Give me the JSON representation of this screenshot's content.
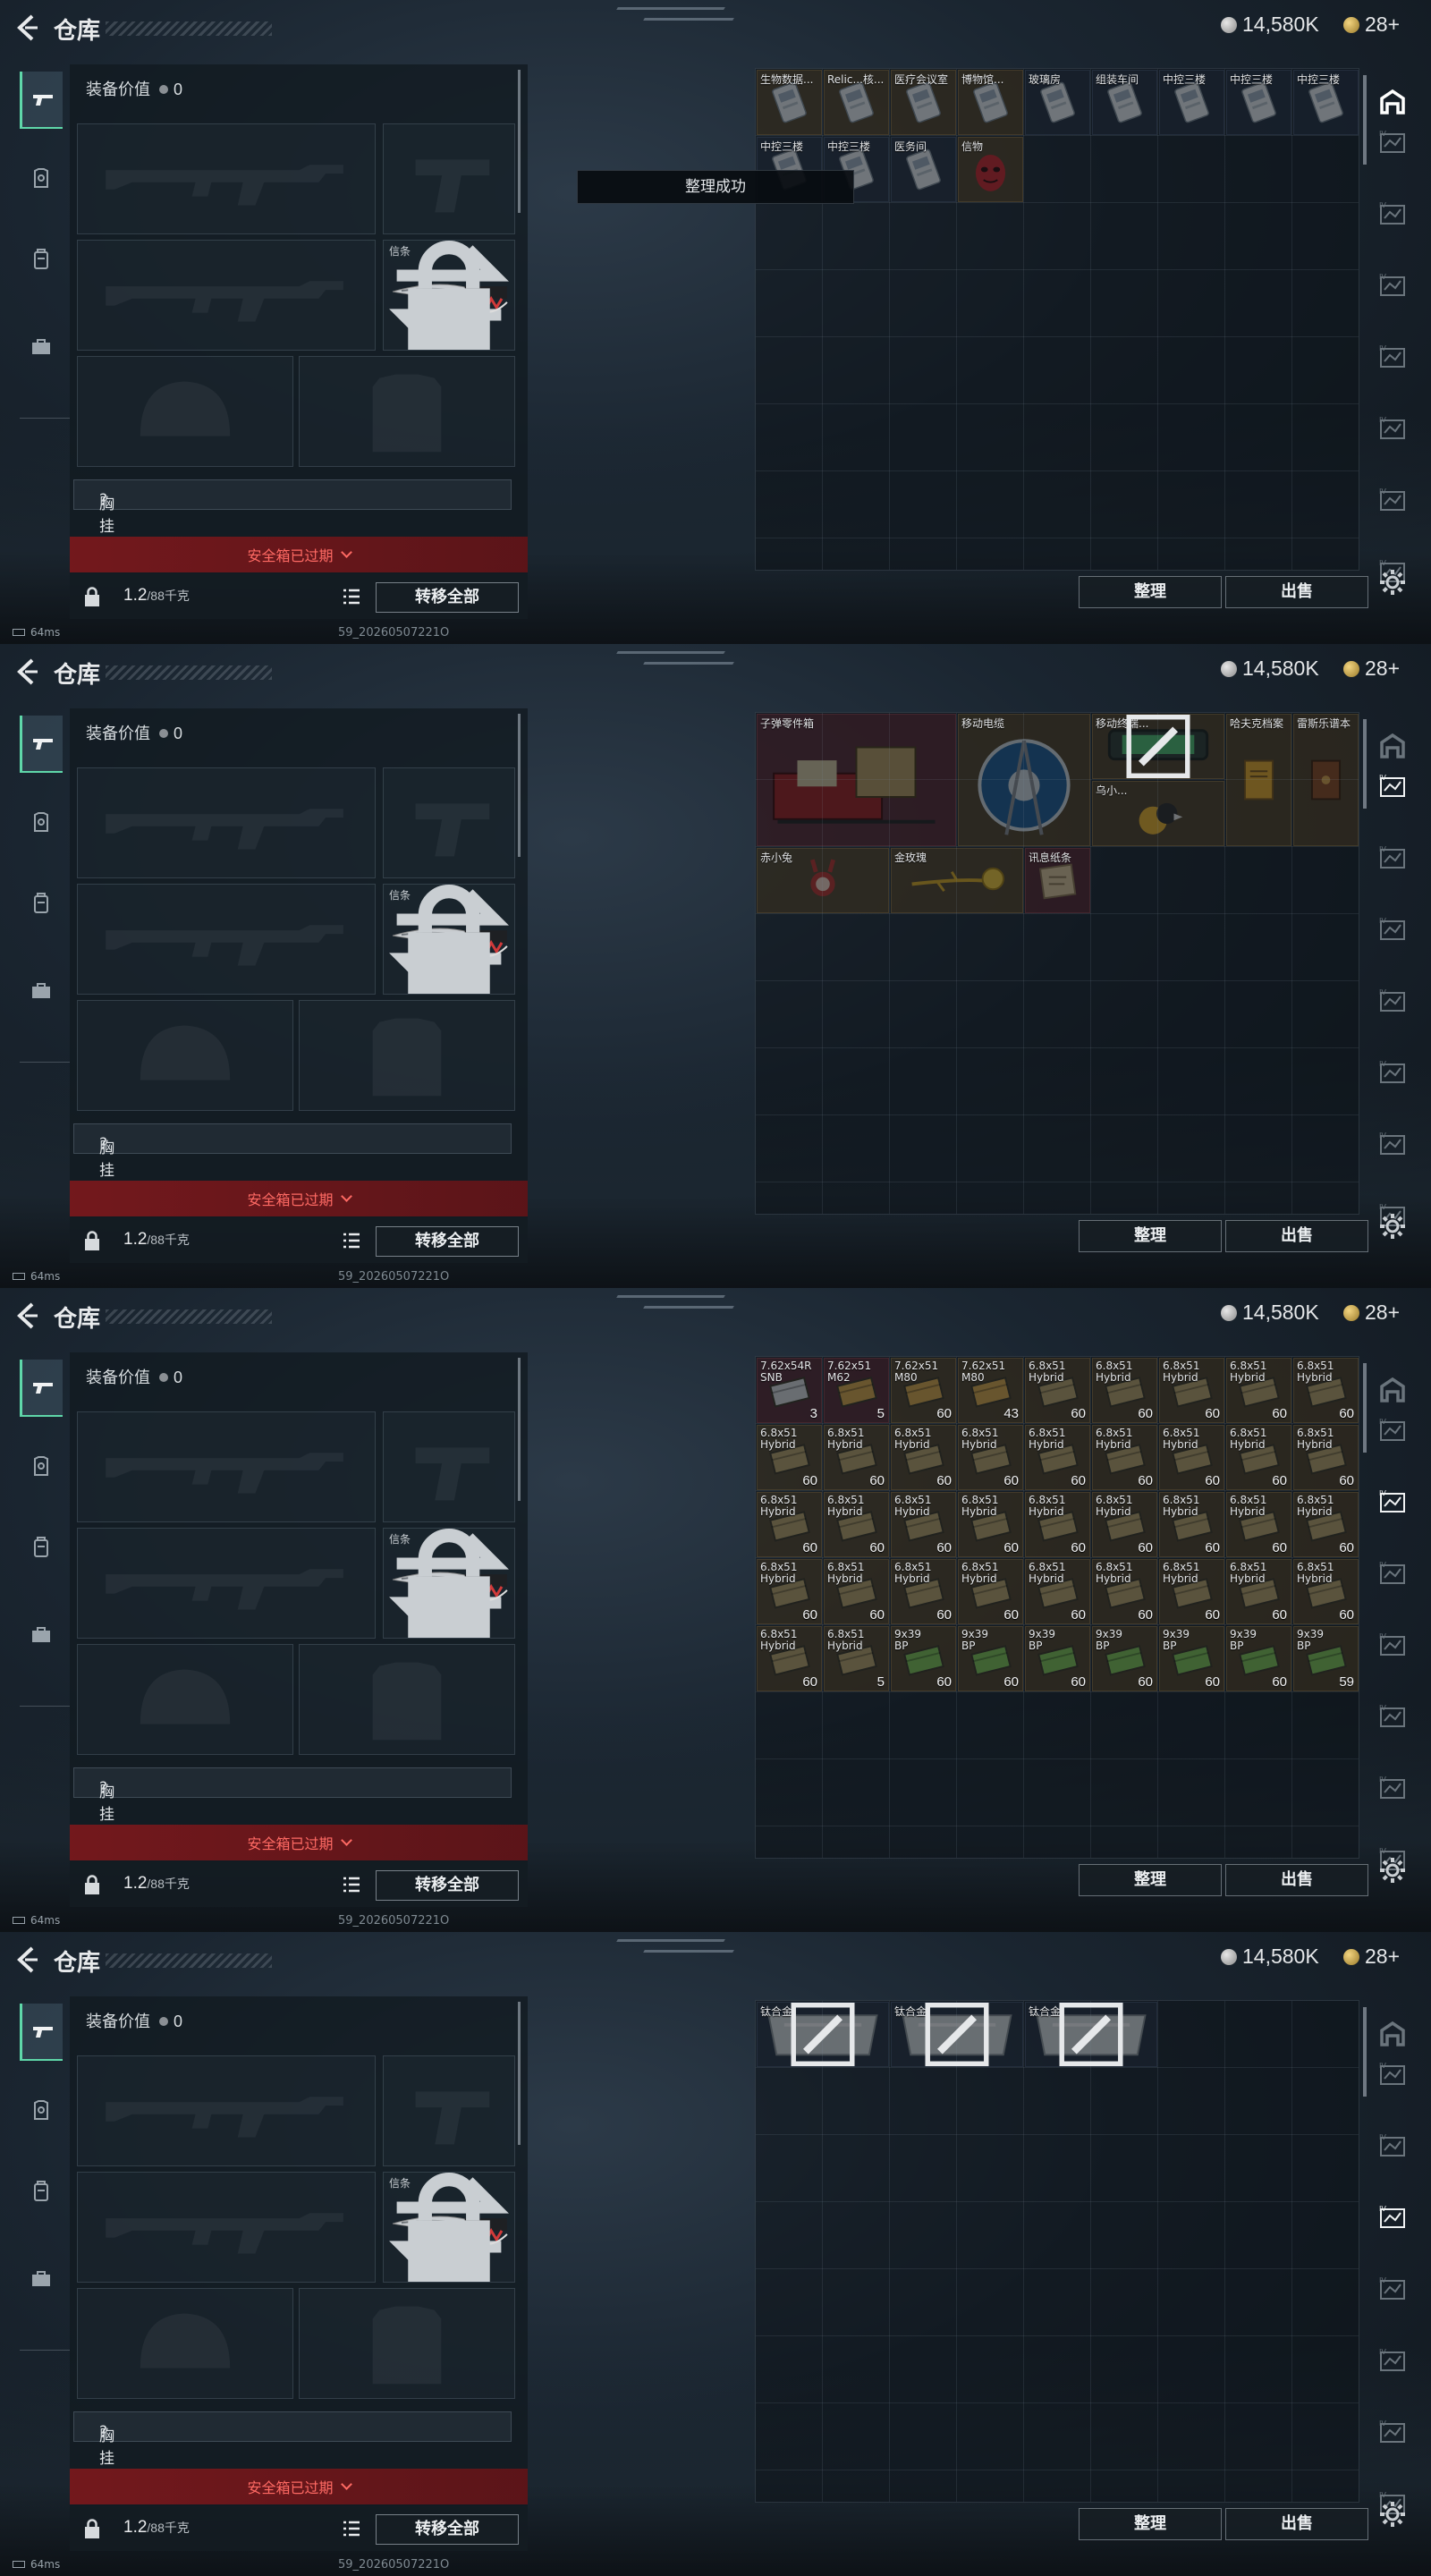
{
  "colors": {
    "accent": "#5fd7a9",
    "danger": "#ff6a64",
    "danger_bg": "#78181c"
  },
  "screens": [
    {
      "title": "仓库",
      "currency_silver": "14,580K",
      "currency_gold": "28+",
      "equip_value_label": "装备价值",
      "equip_value": "0",
      "melee_slot_label": "信条",
      "chest_label": "胸挂",
      "chest_value": "?",
      "safe_box_text": "安全箱已过期",
      "weight": "1.2",
      "weight_max": "/88千克",
      "move_all_label": "转移全部",
      "sort_label": "整理",
      "sell_label": "出售",
      "ping": "64ms",
      "build": "59_20260507221O",
      "toast": "整理成功"
    },
    {
      "title": "仓库",
      "currency_silver": "14,580K",
      "currency_gold": "28+",
      "equip_value_label": "装备价值",
      "equip_value": "0",
      "melee_slot_label": "信条",
      "chest_label": "胸挂",
      "chest_value": "?",
      "safe_box_text": "安全箱已过期",
      "weight": "1.2",
      "weight_max": "/88千克",
      "move_all_label": "转移全部",
      "sort_label": "整理",
      "sell_label": "出售",
      "ping": "64ms",
      "build": "59_20260507221O"
    },
    {
      "title": "仓库",
      "currency_silver": "14,580K",
      "currency_gold": "28+",
      "equip_value_label": "装备价值",
      "equip_value": "0",
      "melee_slot_label": "信条",
      "chest_label": "胸挂",
      "chest_value": "?",
      "safe_box_text": "安全箱已过期",
      "weight": "1.2",
      "weight_max": "/88千克",
      "move_all_label": "转移全部",
      "sort_label": "整理",
      "sell_label": "出售",
      "ping": "64ms",
      "build": "59_20260507221O"
    },
    {
      "title": "仓库",
      "currency_silver": "14,580K",
      "currency_gold": "28+",
      "equip_value_label": "装备价值",
      "equip_value": "0",
      "melee_slot_label": "信条",
      "chest_label": "胸挂",
      "chest_value": "?",
      "safe_box_text": "安全箱已过期",
      "weight": "1.2",
      "weight_max": "/88千克",
      "move_all_label": "转移全部",
      "sort_label": "整理",
      "sell_label": "出售",
      "ping": "64ms",
      "build": "59_20260507221O"
    }
  ],
  "grid1_items": [
    {
      "name": "生物数据...",
      "kind": "keycard",
      "tone": "gold"
    },
    {
      "name": "Relic...核...",
      "kind": "keycard",
      "tone": "gold"
    },
    {
      "name": "医疗会议室",
      "kind": "keycard",
      "tone": "gold"
    },
    {
      "name": "博物馆...",
      "kind": "keycard",
      "tone": "gold"
    },
    {
      "name": "玻璃房",
      "kind": "keycard",
      "tone": "blue"
    },
    {
      "name": "组装车间",
      "kind": "keycard",
      "tone": "blue"
    },
    {
      "name": "中控三楼",
      "kind": "keycard",
      "tone": "blue"
    },
    {
      "name": "中控三楼",
      "kind": "keycard",
      "tone": "blue"
    },
    {
      "name": "中控三楼",
      "kind": "keycard",
      "tone": "blue"
    },
    {
      "name": "中控三楼",
      "kind": "keycard",
      "tone": "blue"
    },
    {
      "name": "中控三楼",
      "kind": "keycard",
      "tone": "blue"
    },
    {
      "name": "医务间",
      "kind": "keycard",
      "tone": "blue"
    },
    {
      "name": "信物",
      "kind": "mask",
      "tone": "gold"
    }
  ],
  "grid2_items": [
    {
      "name": "子弹零件箱",
      "kind": "crate",
      "tone": "red"
    },
    {
      "name": "移动电缆",
      "kind": "reel",
      "tone": "gold"
    },
    {
      "name": "移动终端...",
      "kind": "terminal",
      "tone": "gold"
    },
    {
      "name": "乌小...",
      "kind": "figure",
      "tone": "gold"
    },
    {
      "name": "哈夫克档案",
      "kind": "book",
      "tone": "gold"
    },
    {
      "name": "雷斯乐谱本",
      "kind": "book2",
      "tone": "gold"
    },
    {
      "name": "赤小兔",
      "kind": "figure2",
      "tone": "gold"
    },
    {
      "name": "金玫瑰",
      "kind": "rose",
      "tone": "gold"
    },
    {
      "name": "讯息纸条",
      "kind": "note",
      "tone": "red"
    }
  ],
  "grid3_items": [
    {
      "name": "7.62x54R",
      "sub": "SNB",
      "qty": "3",
      "tone": "red",
      "ammo": "white"
    },
    {
      "name": "7.62x51",
      "sub": "M62",
      "qty": "5",
      "tone": "red",
      "ammo": "gold"
    },
    {
      "name": "7.62x51",
      "sub": "M80",
      "qty": "60",
      "tone": "gold",
      "ammo": "gold"
    },
    {
      "name": "7.62x51",
      "sub": "M80",
      "qty": "43",
      "tone": "gold",
      "ammo": "gold"
    },
    {
      "name": "6.8x51",
      "sub": "Hybrid",
      "qty": "60",
      "tone": "gold",
      "ammo": "tan"
    },
    {
      "name": "6.8x51",
      "sub": "Hybrid",
      "qty": "60",
      "tone": "gold",
      "ammo": "tan"
    },
    {
      "name": "6.8x51",
      "sub": "Hybrid",
      "qty": "60",
      "tone": "gold",
      "ammo": "tan"
    },
    {
      "name": "6.8x51",
      "sub": "Hybrid",
      "qty": "60",
      "tone": "gold",
      "ammo": "tan"
    },
    {
      "name": "6.8x51",
      "sub": "Hybrid",
      "qty": "60",
      "tone": "gold",
      "ammo": "tan"
    },
    {
      "name": "6.8x51",
      "sub": "Hybrid",
      "qty": "60",
      "tone": "gold",
      "ammo": "tan"
    },
    {
      "name": "6.8x51",
      "sub": "Hybrid",
      "qty": "60",
      "tone": "gold",
      "ammo": "tan"
    },
    {
      "name": "6.8x51",
      "sub": "Hybrid",
      "qty": "60",
      "tone": "gold",
      "ammo": "tan"
    },
    {
      "name": "6.8x51",
      "sub": "Hybrid",
      "qty": "60",
      "tone": "gold",
      "ammo": "tan"
    },
    {
      "name": "6.8x51",
      "sub": "Hybrid",
      "qty": "60",
      "tone": "gold",
      "ammo": "tan"
    },
    {
      "name": "6.8x51",
      "sub": "Hybrid",
      "qty": "60",
      "tone": "gold",
      "ammo": "tan"
    },
    {
      "name": "6.8x51",
      "sub": "Hybrid",
      "qty": "60",
      "tone": "gold",
      "ammo": "tan"
    },
    {
      "name": "6.8x51",
      "sub": "Hybrid",
      "qty": "60",
      "tone": "gold",
      "ammo": "tan"
    },
    {
      "name": "6.8x51",
      "sub": "Hybrid",
      "qty": "60",
      "tone": "gold",
      "ammo": "tan"
    },
    {
      "name": "6.8x51",
      "sub": "Hybrid",
      "qty": "60",
      "tone": "gold",
      "ammo": "tan"
    },
    {
      "name": "6.8x51",
      "sub": "Hybrid",
      "qty": "60",
      "tone": "gold",
      "ammo": "tan"
    },
    {
      "name": "6.8x51",
      "sub": "Hybrid",
      "qty": "60",
      "tone": "gold",
      "ammo": "tan"
    },
    {
      "name": "6.8x51",
      "sub": "Hybrid",
      "qty": "60",
      "tone": "gold",
      "ammo": "tan"
    },
    {
      "name": "6.8x51",
      "sub": "Hybrid",
      "qty": "60",
      "tone": "gold",
      "ammo": "tan"
    },
    {
      "name": "6.8x51",
      "sub": "Hybrid",
      "qty": "60",
      "tone": "gold",
      "ammo": "tan"
    },
    {
      "name": "6.8x51",
      "sub": "Hybrid",
      "qty": "60",
      "tone": "gold",
      "ammo": "tan"
    },
    {
      "name": "6.8x51",
      "sub": "Hybrid",
      "qty": "60",
      "tone": "gold",
      "ammo": "tan"
    },
    {
      "name": "6.8x51",
      "sub": "Hybrid",
      "qty": "60",
      "tone": "gold",
      "ammo": "tan"
    },
    {
      "name": "6.8x51",
      "sub": "Hybrid",
      "qty": "60",
      "tone": "gold",
      "ammo": "tan"
    },
    {
      "name": "6.8x51",
      "sub": "Hybrid",
      "qty": "60",
      "tone": "gold",
      "ammo": "tan"
    },
    {
      "name": "6.8x51",
      "sub": "Hybrid",
      "qty": "60",
      "tone": "gold",
      "ammo": "tan"
    },
    {
      "name": "6.8x51",
      "sub": "Hybrid",
      "qty": "60",
      "tone": "gold",
      "ammo": "tan"
    },
    {
      "name": "6.8x51",
      "sub": "Hybrid",
      "qty": "60",
      "tone": "gold",
      "ammo": "tan"
    },
    {
      "name": "6.8x51",
      "sub": "Hybrid",
      "qty": "60",
      "tone": "gold",
      "ammo": "tan"
    },
    {
      "name": "6.8x51",
      "sub": "Hybrid",
      "qty": "60",
      "tone": "gold",
      "ammo": "tan"
    },
    {
      "name": "6.8x51",
      "sub": "Hybrid",
      "qty": "60",
      "tone": "gold",
      "ammo": "tan"
    },
    {
      "name": "6.8x51",
      "sub": "Hybrid",
      "qty": "60",
      "tone": "gold",
      "ammo": "tan"
    },
    {
      "name": "6.8x51",
      "sub": "Hybrid",
      "qty": "60",
      "tone": "gold",
      "ammo": "tan"
    },
    {
      "name": "6.8x51",
      "sub": "Hybrid",
      "qty": "5",
      "tone": "gold",
      "ammo": "tan"
    },
    {
      "name": "9x39",
      "sub": "BP",
      "qty": "60",
      "tone": "gold",
      "ammo": "green"
    },
    {
      "name": "9x39",
      "sub": "BP",
      "qty": "60",
      "tone": "gold",
      "ammo": "green"
    },
    {
      "name": "9x39",
      "sub": "BP",
      "qty": "60",
      "tone": "gold",
      "ammo": "green"
    },
    {
      "name": "9x39",
      "sub": "BP",
      "qty": "60",
      "tone": "gold",
      "ammo": "green"
    },
    {
      "name": "9x39",
      "sub": "BP",
      "qty": "60",
      "tone": "gold",
      "ammo": "green"
    },
    {
      "name": "9x39",
      "sub": "BP",
      "qty": "60",
      "tone": "gold",
      "ammo": "green"
    },
    {
      "name": "9x39",
      "sub": "BP",
      "qty": "59",
      "tone": "gold",
      "ammo": "green"
    }
  ],
  "grid4_items": [
    {
      "name": "钛合金",
      "kind": "plate",
      "tone": "blue"
    },
    {
      "name": "钛合金",
      "kind": "plate",
      "tone": "blue"
    },
    {
      "name": "钛合金",
      "kind": "plate",
      "tone": "blue"
    }
  ]
}
